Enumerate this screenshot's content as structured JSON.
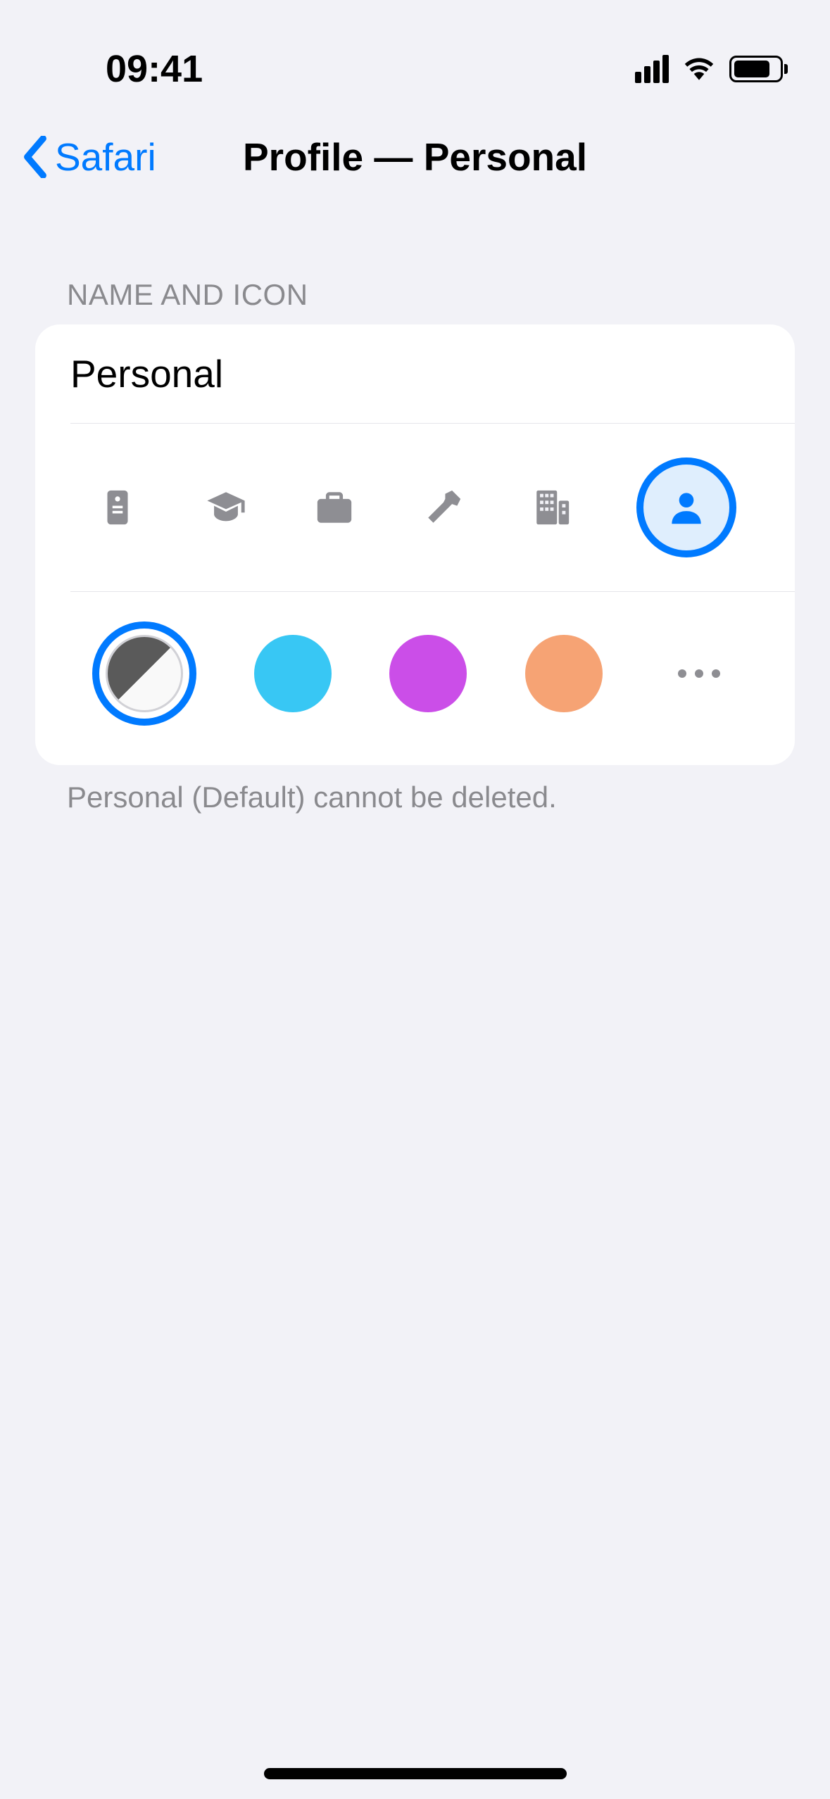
{
  "status": {
    "time": "09:41"
  },
  "nav": {
    "back_label": "Safari",
    "title": "Profile — Personal"
  },
  "section": {
    "header": "NAME AND ICON",
    "profile_name": "Personal",
    "footer": "Personal (Default) cannot be deleted."
  },
  "icons": {
    "options": [
      "badge",
      "graduation",
      "briefcase",
      "hammer",
      "building",
      "person"
    ],
    "selected": "person"
  },
  "colors": {
    "options": [
      {
        "id": "default",
        "value": "split"
      },
      {
        "id": "cyan",
        "value": "#38c7f4"
      },
      {
        "id": "magenta",
        "value": "#cb4ee8"
      },
      {
        "id": "orange",
        "value": "#f6a374"
      }
    ],
    "selected": "default"
  }
}
